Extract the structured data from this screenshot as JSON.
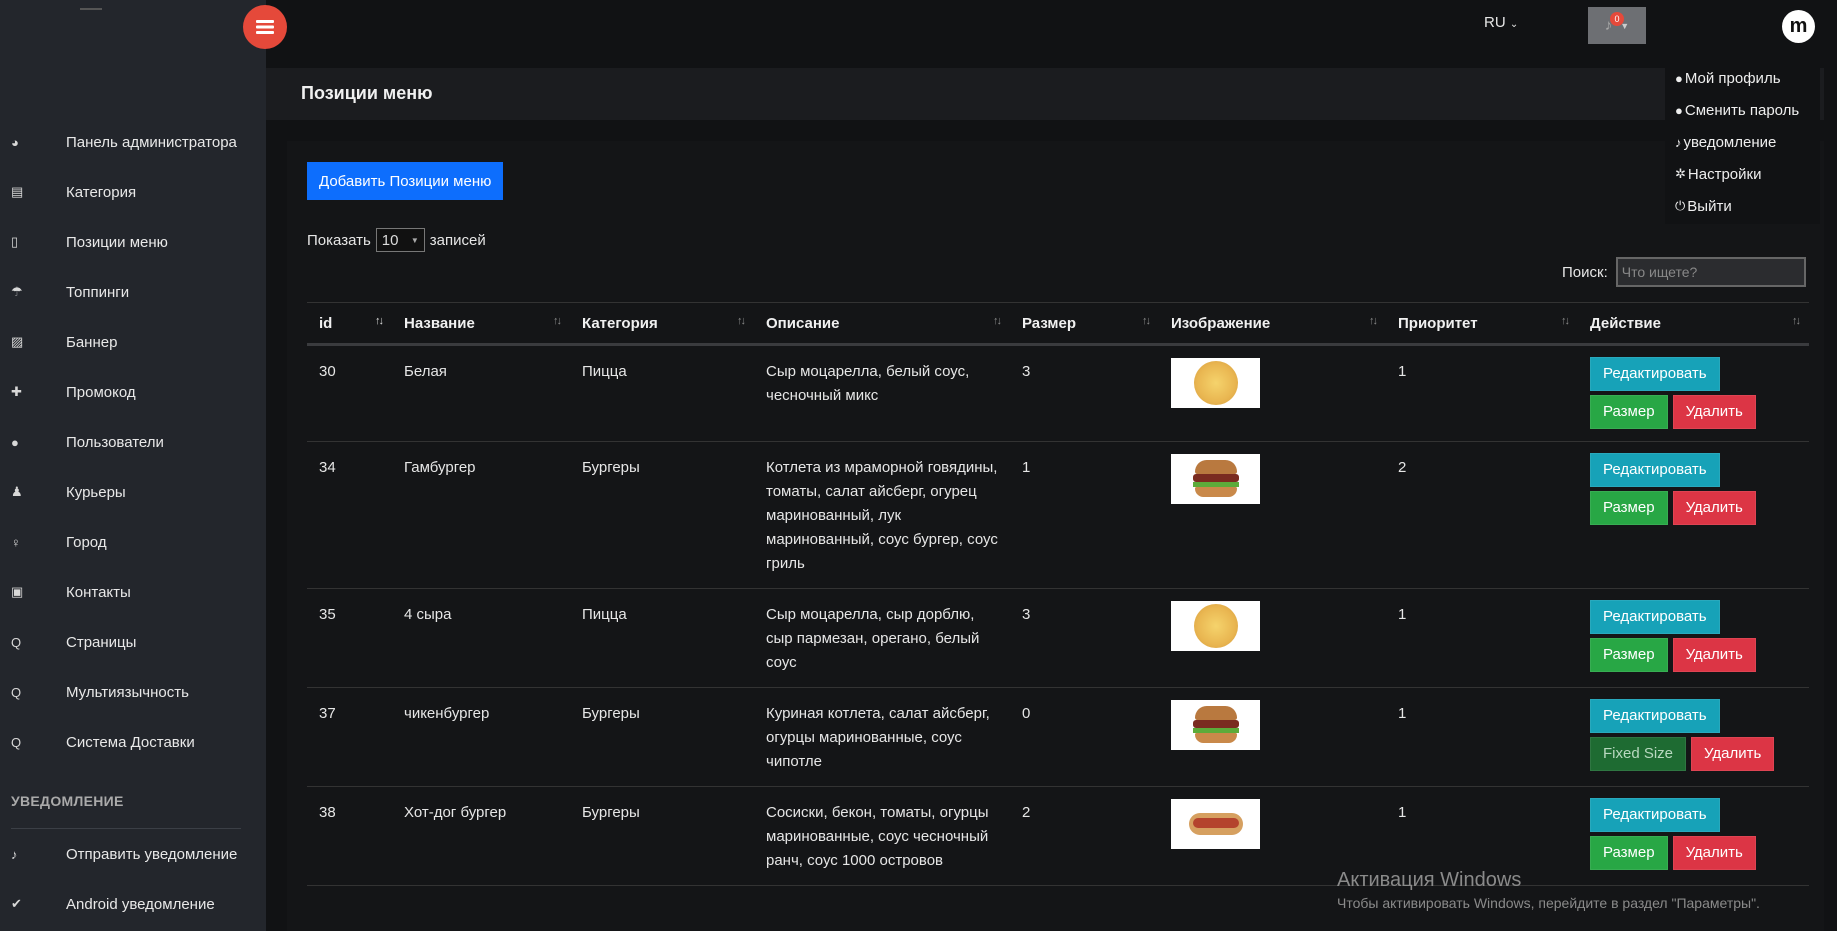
{
  "sidebar": {
    "items": [
      {
        "label": "Панель администратора",
        "icon": "dashboard-icon",
        "glyph": "◕"
      },
      {
        "label": "Категория",
        "icon": "list-icon",
        "glyph": "▤"
      },
      {
        "label": "Позиции меню",
        "icon": "document-icon",
        "glyph": "▯"
      },
      {
        "label": "Топпинги",
        "icon": "umbrella-icon",
        "glyph": "☂"
      },
      {
        "label": "Баннер",
        "icon": "image-icon",
        "glyph": "▨"
      },
      {
        "label": "Промокод",
        "icon": "gift-icon",
        "glyph": "✚"
      },
      {
        "label": "Пользователи",
        "icon": "user-icon",
        "glyph": "●"
      },
      {
        "label": "Курьеры",
        "icon": "male-icon",
        "glyph": "♟"
      },
      {
        "label": "Город",
        "icon": "pin-icon",
        "glyph": "♀"
      },
      {
        "label": "Контакты",
        "icon": "contact-book-icon",
        "glyph": "▣"
      },
      {
        "label": "Страницы",
        "icon": "search-icon",
        "glyph": "Q"
      },
      {
        "label": "Мультиязычность",
        "icon": "search-icon",
        "glyph": "Q"
      },
      {
        "label": "Система Доставки",
        "icon": "search-icon",
        "glyph": "Q"
      }
    ],
    "notifications_heading": "УВЕДОМЛЕНИЕ",
    "notification_items": [
      {
        "label": "Отправить уведомление",
        "icon": "bell-icon",
        "glyph": "♪"
      },
      {
        "label": "Android уведомление",
        "icon": "check-icon",
        "glyph": "✔"
      }
    ]
  },
  "header": {
    "language": "RU",
    "notification_count": "0",
    "avatar_letter": "m"
  },
  "page": {
    "title": "Позиции меню"
  },
  "profile_menu": [
    {
      "label": "Мой профиль",
      "icon": "user-icon",
      "glyph": "●"
    },
    {
      "label": "Сменить пароль",
      "icon": "user-icon",
      "glyph": "●"
    },
    {
      "label": "уведомление",
      "icon": "bell-icon",
      "glyph": "♪"
    },
    {
      "label": "Настройки",
      "icon": "gear-icon",
      "glyph": "✲"
    },
    {
      "label": "Выйти",
      "icon": "power-icon",
      "glyph": "⏻"
    }
  ],
  "content": {
    "add_button": "Добавить Позиции меню",
    "show_label": "Показать",
    "page_size": "10",
    "entries_label": "записей",
    "search_label": "Поиск:",
    "search_placeholder": "Что ищете?"
  },
  "table": {
    "columns": [
      "id",
      "Название",
      "Категория",
      "Описание",
      "Размер",
      "Изображение",
      "Приоритет",
      "Действие"
    ],
    "rows": [
      {
        "id": "30",
        "name": "Белая",
        "category": "Пицца",
        "description": "Сыр моцарелла, белый соус, чесночный микс",
        "size": "3",
        "image": "pizza",
        "priority": "1",
        "size_button": "Размер"
      },
      {
        "id": "34",
        "name": "Гамбургер",
        "category": "Бургеры",
        "description": "Котлета из мраморной говядины, томаты, салат айсберг, огурец маринованный, лук маринованный, соус бургер, соус гриль",
        "size": "1",
        "image": "burger",
        "priority": "2",
        "size_button": "Размер"
      },
      {
        "id": "35",
        "name": "4 сыра",
        "category": "Пицца",
        "description": "Сыр моцарелла, сыр дорблю, сыр пармезан, орегано, белый соус",
        "size": "3",
        "image": "pizza",
        "priority": "1",
        "size_button": "Размер"
      },
      {
        "id": "37",
        "name": "чикенбургер",
        "category": "Бургеры",
        "description": "Куриная котлета, салат айсберг, огурцы маринованные, соус чипотле",
        "size": "0",
        "image": "burger",
        "priority": "1",
        "size_button": "Fixed Size"
      },
      {
        "id": "38",
        "name": "Хот-дог бургер",
        "category": "Бургеры",
        "description": "Сосиски, бекон, томаты, огурцы маринованные, соус чесночный ранч, соус 1000 островов",
        "size": "2",
        "image": "hotdog",
        "priority": "1",
        "size_button": "Размер"
      }
    ],
    "edit_label": "Редактировать",
    "delete_label": "Удалить"
  },
  "watermark": {
    "title": "Активация Windows",
    "subtitle": "Чтобы активировать Windows, перейдите в раздел \"Параметры\"."
  }
}
